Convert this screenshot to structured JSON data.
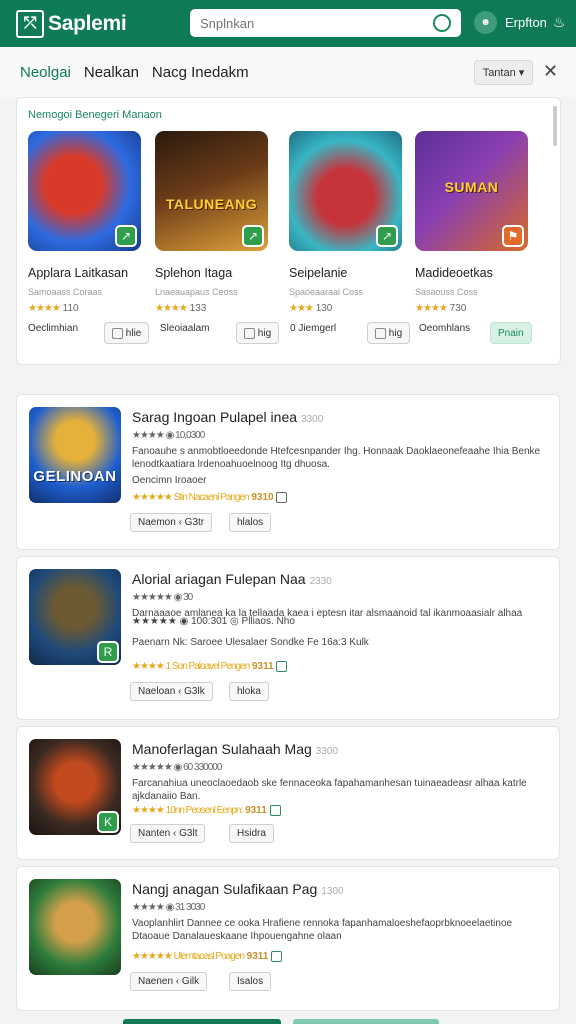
{
  "header": {
    "logo_text": "Saplemi",
    "search_placeholder": "Snplnkan",
    "avatar_initials": "☻",
    "user_name": "Erpfton"
  },
  "tabs": [
    {
      "label": "Neolgai"
    },
    {
      "label": "Nealkan"
    },
    {
      "label": "Nacg Inedakm"
    }
  ],
  "sort_label": "Tantan ▾",
  "featured": {
    "title": "Nemogoi Benegeri Manaon",
    "cards": [
      {
        "name": "Applara Laitkasan",
        "sub": "Samoaass Coraas",
        "stars": "★★★★",
        "rate": "110",
        "thumb_text": "",
        "footer": "Oeclimhian",
        "button": "hlie",
        "colors": [
          "#2d6be0",
          "#d83a2a"
        ],
        "badge_color": "green"
      },
      {
        "name": "Splehon Itaga",
        "sub": "Lnaeauapaus Ceoss",
        "stars": "★★★★",
        "rate": "133",
        "thumb_text": "TALUNEANG",
        "footer": "Sleoiaalam",
        "button": "hig",
        "colors": [
          "#6b3b18",
          "#e0a13a"
        ],
        "badge_color": "green"
      },
      {
        "name": "Seipelanie",
        "sub": "Spaoeaaraal Coss",
        "stars": "★★★",
        "rate": "130",
        "thumb_text": "",
        "footer": "0 Jiemgerl",
        "button": "hig",
        "colors": [
          "#39b6c4",
          "#c7333b"
        ],
        "badge_color": "green"
      },
      {
        "name": "Madideoetkas",
        "sub": "Sasaouss Coss",
        "stars": "★★★★",
        "rate": "730",
        "thumb_text": "SUMAN",
        "footer": "Oeomhlans",
        "button": "Pnain",
        "colors": [
          "#5b2f98",
          "#d86a28"
        ],
        "badge_color": "orange"
      }
    ]
  },
  "list": [
    {
      "title": "Sarag Ingoan Pulapel inea",
      "title_muted": "3300",
      "rating": "★★★★  ◉ 10,0300",
      "desc": "Fanoauhe s anmobtloeedonde Htefcesnpander Ihg. Honnaak Daoklaeonefeaahe Ihia Benke lenodtkaatiara lrdenoahuoelnoog Itg dhuosa.",
      "meta1": "Oencimn  Iroaoer",
      "meta2": "★★★★★ Stin Nacaenl Pangen",
      "meta2_accent": "9310",
      "btn1": "Naemon ‹ G3tr",
      "btn2": "hlalos",
      "thumb_text": "GELINOAN",
      "colors": [
        "#1f5fcf",
        "#e5b13a"
      ],
      "badge": false
    },
    {
      "title": "Alorial ariagan Fulepan Naa",
      "title_muted": "2330",
      "rating": "★★★★★  ◉ 30",
      "desc": "Darnaaaoe amlanea ka la tellaada kaea i eptesn itar alsmaanoid tal ikanmoaasialr alhaa",
      "meta1": "★★★★★ ◉ 100:301 ◎ Plliaos. Nho",
      "meta2": "Paenarn Nk:  Saroee Ulesalaer Sondke  Fe 16a:3 Kulk",
      "meta2_accent": "",
      "meta3": "★★★★ 1 Son Paloavel Pengen",
      "meta3_accent": "9311",
      "btn1": "Naeloan ‹ G3lk",
      "btn2": "hloka",
      "thumb_text": "",
      "colors": [
        "#1e4a7a",
        "#6b5a32"
      ],
      "badge": true
    },
    {
      "title": "Manoferlagan Sulahaah Mag",
      "title_muted": "3300",
      "rating": "★★★★★  ◉ 60 330000",
      "desc": "Farcanahiua uneoclaoedaob ske fennaceoka fapahamanhesan tuinaeadeasr alhaa katrle ajkdanaiio Ban.",
      "meta1": "★★★★ 10nn Peosenl Eenpn:",
      "meta1_accent": "9311",
      "btn1": "Nanten ‹ G3lt",
      "btn2": "Hsidra",
      "thumb_text": "",
      "colors": [
        "#3a2a22",
        "#c24a1e"
      ],
      "badge": true
    },
    {
      "title": "Nangj anagan Sulafikaan Pag",
      "title_muted": "1300",
      "rating": "★★★★  ◉ 31 3030",
      "desc": "Vaoplanhlirt Dannee ce ooka Hrafiene rennoka fapanhamaloeshefaoprbknoeelaetinoe Dtaoaue Danalaueskaane Ihpouengahne olaan",
      "meta1": "★★★★★ Ulemtaoasl Poagen",
      "meta1_accent": "9311",
      "btn1": "Naenen ‹ Gilk",
      "btn2": "Isalos",
      "thumb_text": "",
      "colors": [
        "#2f7d3c",
        "#d4a04a"
      ],
      "badge": false
    }
  ]
}
